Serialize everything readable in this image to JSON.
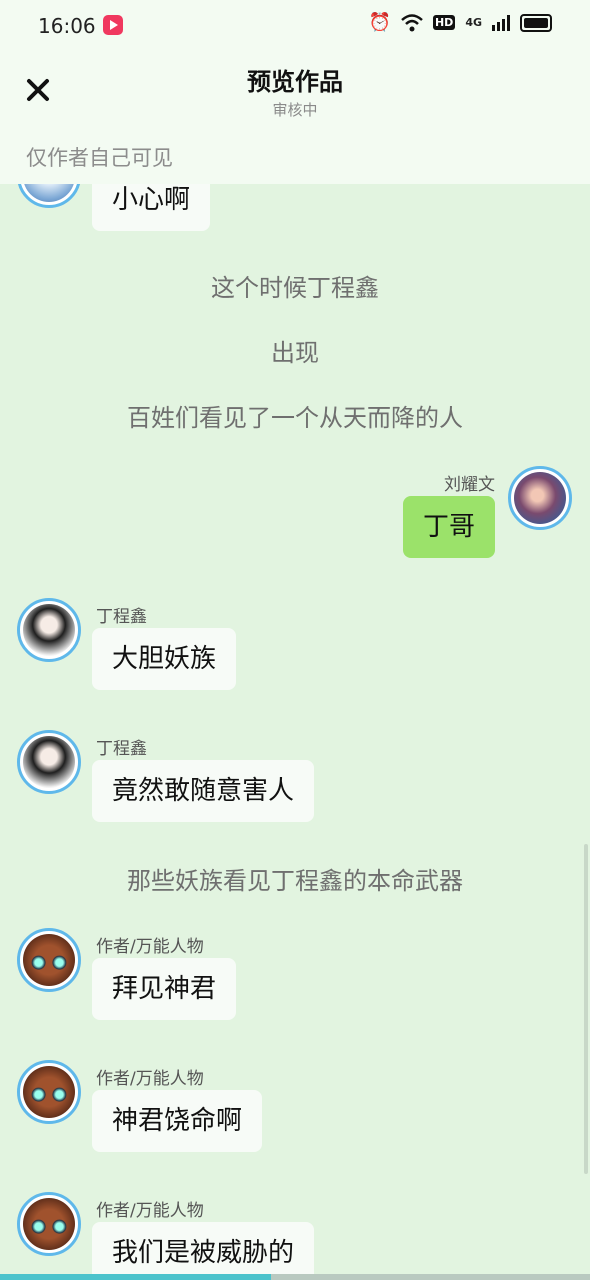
{
  "status_bar": {
    "time": "16:06",
    "network": "4G",
    "hd": "HD"
  },
  "header": {
    "title": "预览作品",
    "subtitle": "审核中"
  },
  "visibility_note": "仅作者自己可见",
  "messages": [
    {
      "type": "bubble",
      "name": "",
      "text": "小心啊"
    },
    {
      "type": "narration",
      "text": "这个时候丁程鑫"
    },
    {
      "type": "narration",
      "text": "出现"
    },
    {
      "type": "narration",
      "text": "百姓们看见了一个从天而降的人"
    },
    {
      "type": "bubble_right",
      "name": "刘耀文",
      "text": "丁哥"
    },
    {
      "type": "bubble",
      "name": "丁程鑫",
      "text": "大胆妖族"
    },
    {
      "type": "bubble",
      "name": "丁程鑫",
      "text": "竟然敢随意害人"
    },
    {
      "type": "narration",
      "text": "那些妖族看见丁程鑫的本命武器"
    },
    {
      "type": "bubble",
      "name": "作者/万能人物",
      "text": "拜见神君"
    },
    {
      "type": "bubble",
      "name": "作者/万能人物",
      "text": "神君饶命啊"
    },
    {
      "type": "bubble",
      "name": "作者/万能人物",
      "text": "我们是被威胁的"
    }
  ],
  "progress": {
    "value": 0.46
  },
  "colors": {
    "background": "#e2f4e0",
    "right_bubble": "#9be26a",
    "avatar_ring": "#5fb8ea"
  },
  "icons": {
    "close": "close-icon",
    "app": "video-app-icon"
  }
}
